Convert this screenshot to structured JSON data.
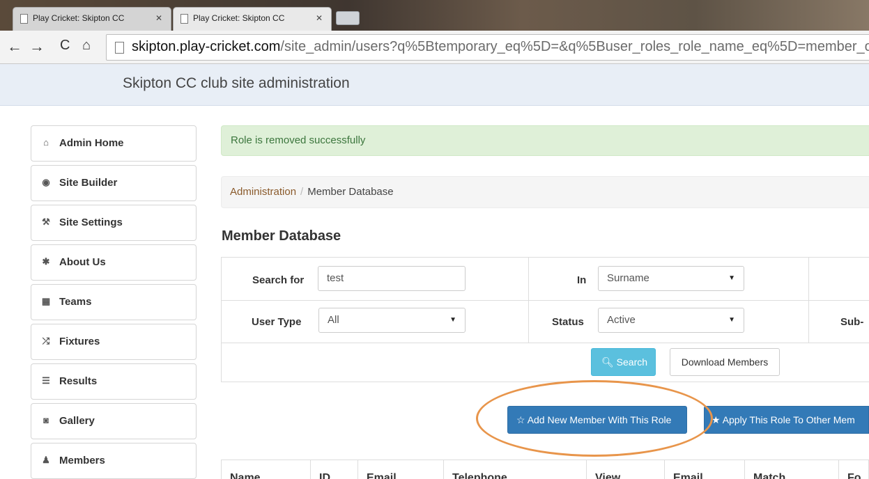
{
  "browser": {
    "tabs": [
      {
        "title": "Play Cricket: Skipton CC",
        "active": false
      },
      {
        "title": "Play Cricket: Skipton CC",
        "active": true
      }
    ],
    "url_host": "skipton.play-cricket.com",
    "url_path": "/site_admin/users?q%5Btemporary_eq%5D=&q%5Buser_roles_role_name_eq%5D=member_of_the_we"
  },
  "header": {
    "title": "Skipton CC club site administration"
  },
  "sidebar": {
    "items": [
      {
        "label": "Admin Home",
        "icon": "home-icon",
        "glyph": "🏠"
      },
      {
        "label": "Site Builder",
        "icon": "globe-icon",
        "glyph": "◉"
      },
      {
        "label": "Site Settings",
        "icon": "wrench-icon",
        "glyph": "🔧"
      },
      {
        "label": "About Us",
        "icon": "asterisk-icon",
        "glyph": "✱"
      },
      {
        "label": "Teams",
        "icon": "grid-icon",
        "glyph": "▦"
      },
      {
        "label": "Fixtures",
        "icon": "shuffle-icon",
        "glyph": "⤮"
      },
      {
        "label": "Results",
        "icon": "list-icon",
        "glyph": "☰"
      },
      {
        "label": "Gallery",
        "icon": "camera-icon",
        "glyph": "◙"
      },
      {
        "label": "Members",
        "icon": "user-icon",
        "glyph": "👤"
      }
    ]
  },
  "alert": {
    "message": "Role is removed successfully"
  },
  "breadcrumb": {
    "link": "Administration",
    "separator": "/",
    "current": "Member Database"
  },
  "page": {
    "title": "Member Database"
  },
  "search": {
    "search_for_label": "Search for",
    "search_for_value": "test",
    "in_label": "In",
    "in_value": "Surname",
    "user_type_label": "User Type",
    "user_type_value": "All",
    "status_label": "Status",
    "status_value": "Active",
    "sub_label": "Sub-",
    "search_button": "Search",
    "download_button": "Download Members"
  },
  "actions": {
    "add_member": "Add New Member With This Role",
    "apply_role": "Apply This Role To Other Mem"
  },
  "table": {
    "headers": [
      "Name",
      "ID",
      "Email",
      "Telephone",
      "View",
      "Email",
      "Match",
      "Fo"
    ]
  },
  "colors": {
    "alert_bg": "#dff0d8",
    "primary": "#337ab7",
    "info": "#5bc0de",
    "highlight": "#e8954b"
  }
}
